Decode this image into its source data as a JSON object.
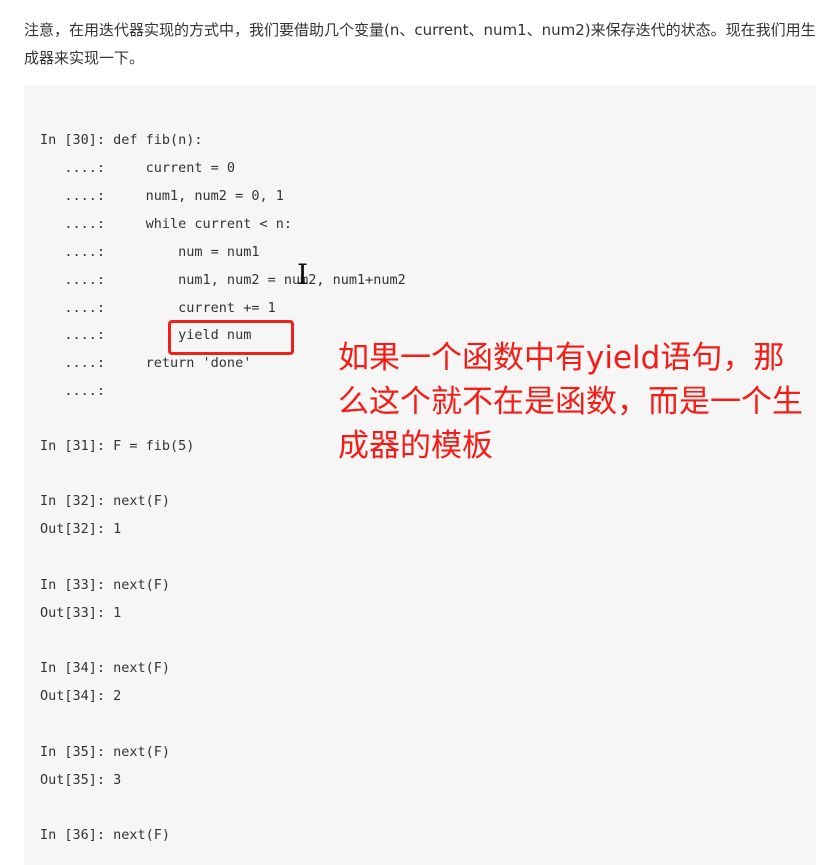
{
  "paragraph": "注意，在用迭代器实现的方式中，我们要借助几个变量(n、current、num1、num2)来保存迭代的状态。现在我们用生成器来实现一下。",
  "code_lines": [
    "In [30]: def fib(n):",
    "   ....:     current = 0",
    "   ....:     num1, num2 = 0, 1",
    "   ....:     while current < n:",
    "   ....:         num = num1",
    "   ....:         num1, num2 = num2, num1+num2",
    "   ....:         current += 1",
    "   ....:         yield num",
    "   ....:     return 'done'",
    "   ....:",
    "In [31]: F = fib(5)",
    "In [32]: next(F)",
    "Out[32]: 1",
    "In [33]: next(F)",
    "Out[33]: 1",
    "In [34]: next(F)",
    "Out[34]: 2",
    "In [35]: next(F)",
    "Out[35]: 3",
    "In [36]: next(F)"
  ],
  "annotation": "如果一个函数中有yield语句，那么这个就不在是函数，而是一个生成器的模板",
  "colors": {
    "annotation": "#f41c14",
    "code_bg": "#f6f6f6"
  },
  "cursor_icon": "text-cursor-ibeam"
}
